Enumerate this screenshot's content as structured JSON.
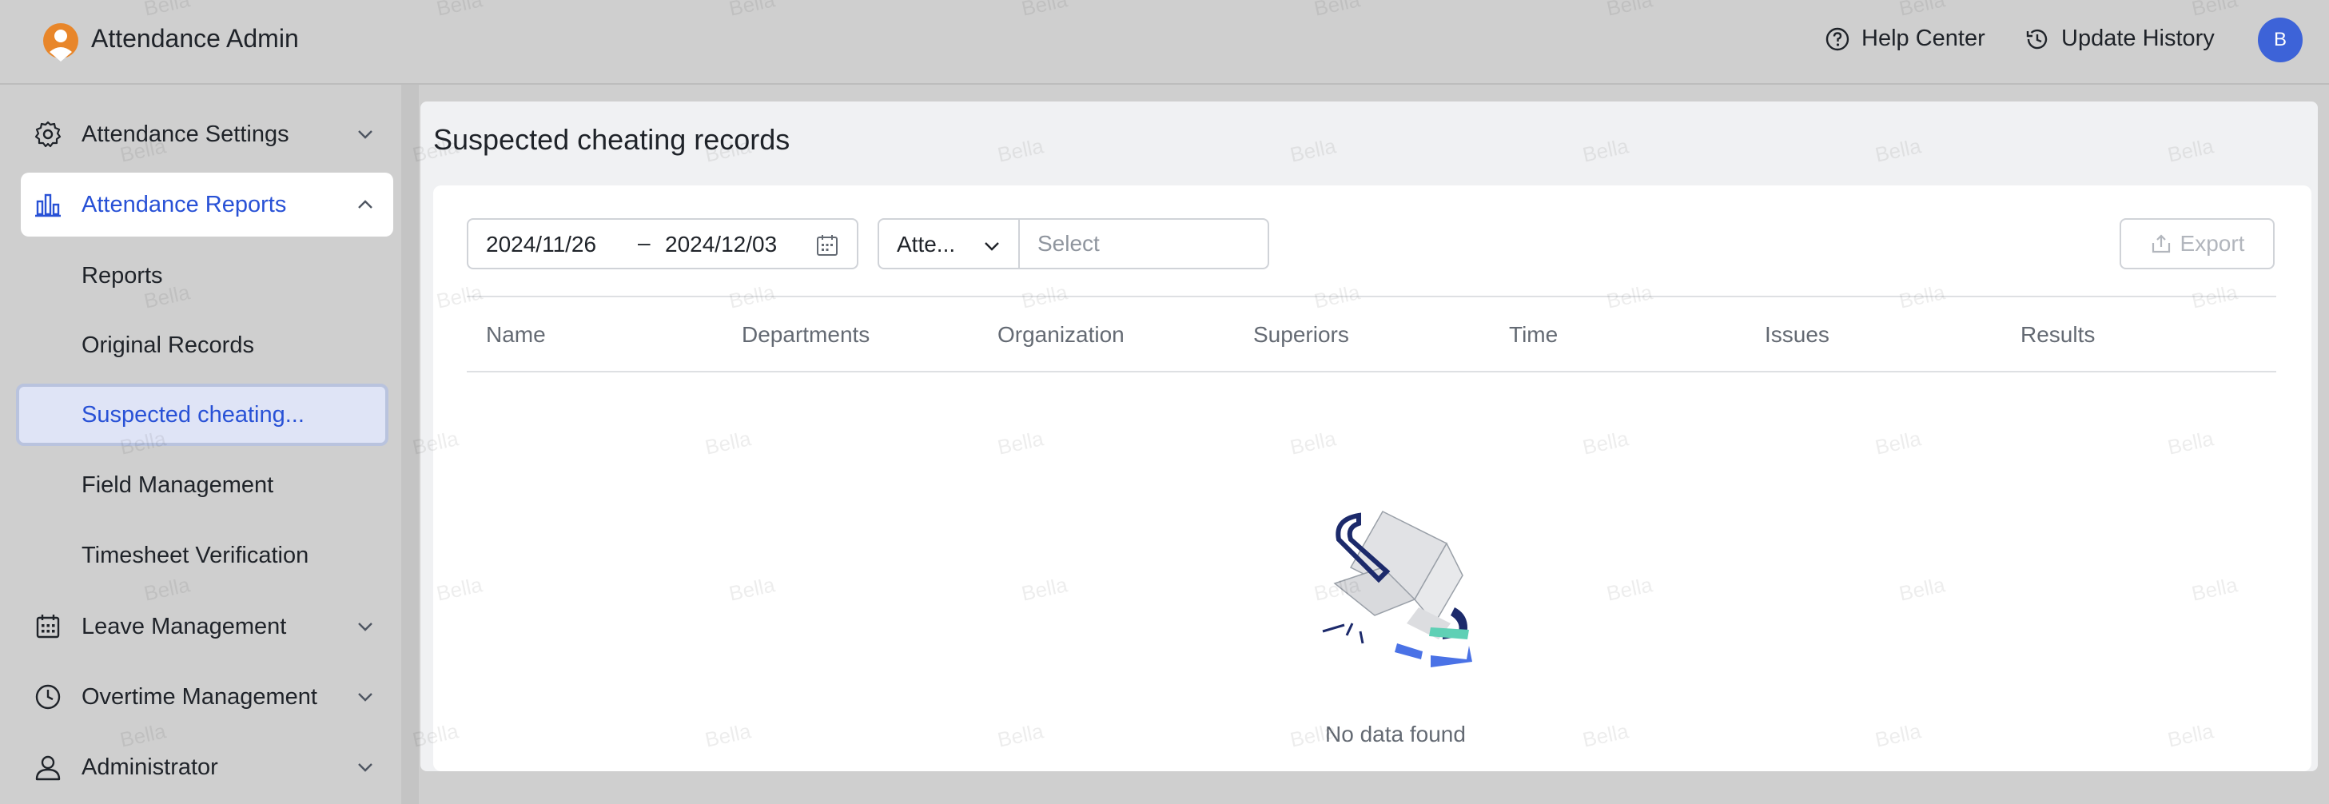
{
  "header": {
    "app_title": "Attendance Admin",
    "help_label": "Help Center",
    "history_label": "Update History",
    "avatar_initial": "B"
  },
  "sidebar": {
    "items": [
      {
        "label": "Attendance Settings",
        "icon": "gear-icon",
        "state": "collapsed"
      },
      {
        "label": "Attendance Reports",
        "icon": "bar-chart-icon",
        "state": "expanded"
      },
      {
        "label": "Leave Management",
        "icon": "calendar-icon",
        "state": "collapsed"
      },
      {
        "label": "Overtime Management",
        "icon": "clock-icon",
        "state": "collapsed"
      },
      {
        "label": "Administrator",
        "icon": "user-icon",
        "state": "collapsed"
      }
    ],
    "report_subitems": [
      {
        "label": "Reports"
      },
      {
        "label": "Original Records"
      },
      {
        "label": "Suspected cheating..."
      },
      {
        "label": "Field Management"
      },
      {
        "label": "Timesheet Verification"
      }
    ],
    "selected_subitem": "Suspected cheating..."
  },
  "main": {
    "page_title": "Suspected cheating records",
    "filters": {
      "date_start": "2024/11/26",
      "date_separator": "–",
      "date_end": "2024/12/03",
      "type_value": "Atte...",
      "select_placeholder": "Select"
    },
    "export_label": "Export",
    "columns": [
      "Name",
      "Departments",
      "Organization",
      "Superiors",
      "Time",
      "Issues",
      "Results"
    ],
    "empty_text": "No data found"
  },
  "watermark": "Bella",
  "colors": {
    "accent": "#2851d6",
    "avatar_bg": "#3d63d8",
    "selected_bg": "#dfe4f6",
    "logo": "#e8862a"
  }
}
